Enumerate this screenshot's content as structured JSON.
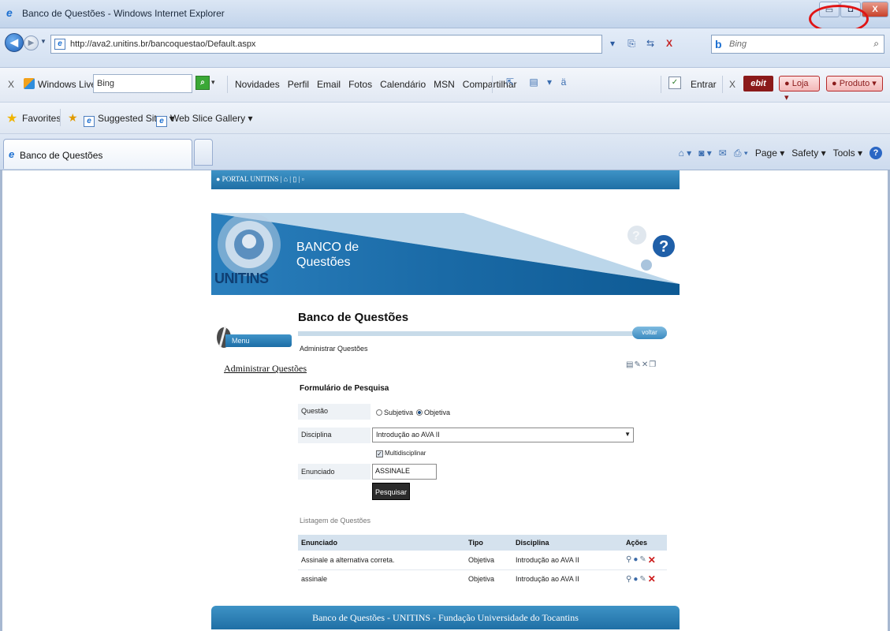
{
  "window": {
    "title": "Banco de Questões - Windows Internet Explorer",
    "minimize_glyph": "▭",
    "maximize_glyph": "◘",
    "close_glyph": "X"
  },
  "address_bar": {
    "url": "http://ava2.unitins.br/bancoquestao/Default.aspx",
    "search_placeholder": "Bing",
    "stop_glyph": "X"
  },
  "live_toolbar": {
    "close_glyph": "X",
    "brand": "Windows Live",
    "search_value": "Bing",
    "links": [
      "Novidades",
      "Perfil",
      "Email",
      "Fotos",
      "Calendário",
      "MSN",
      "Compartilhar"
    ],
    "signin": "Entrar",
    "ebit_label": "ebit",
    "loja_label": "Loja",
    "produto_label": "Produto"
  },
  "favorites_bar": {
    "label": "Favorites",
    "items": [
      "Suggested Sites ▾",
      "Web Slice Gallery ▾"
    ]
  },
  "tabs": [
    {
      "label": "Banco de Questões"
    }
  ],
  "command_bar": {
    "page": "Page ▾",
    "safety": "Safety ▾",
    "tools": "Tools ▾",
    "help_glyph": "?"
  },
  "site": {
    "portal_link": "● PORTAL UNITINS  |  ⌂  |  ▯  |  ▫",
    "logo_text": "UNITINS",
    "banner_line1": "BANCO de",
    "banner_line2": "Questões",
    "menu_label": "Menu",
    "sidebar_link": "Administrar Questões",
    "page_title": "Banco de Questões",
    "back_button": "voltar",
    "breadcrumb": "Administrar Questões",
    "footer": "Banco de Questões - UNITINS - Fundação Universidade do Tocantins"
  },
  "search_form": {
    "title": "Formulário de Pesquisa",
    "questao_label": "Questão",
    "radio_subjetiva": "Subjetiva",
    "radio_objetiva": "Objetiva",
    "selected_type": "Objetiva",
    "disciplina_label": "Disciplina",
    "disciplina_value": "Introdução ao AVA II",
    "multidisciplinar_label": "Multidisciplinar",
    "multidisciplinar_checked": true,
    "enunciado_label": "Enunciado",
    "enunciado_value": "ASSINALE",
    "submit_label": "Pesquisar"
  },
  "results": {
    "title": "Listagem de Questões",
    "columns": [
      "Enunciado",
      "Tipo",
      "Disciplina",
      "Ações"
    ],
    "rows": [
      {
        "enunciado": "Assinale a alternativa correta.",
        "tipo": "Objetiva",
        "disciplina": "Introdução ao AVA II"
      },
      {
        "enunciado": "assinale",
        "tipo": "Objetiva",
        "disciplina": "Introdução ao AVA II"
      }
    ]
  },
  "colors": {
    "accent_blue": "#1f6fa5",
    "annotation_red": "#e01515",
    "delete_red": "#cc1a1a"
  }
}
